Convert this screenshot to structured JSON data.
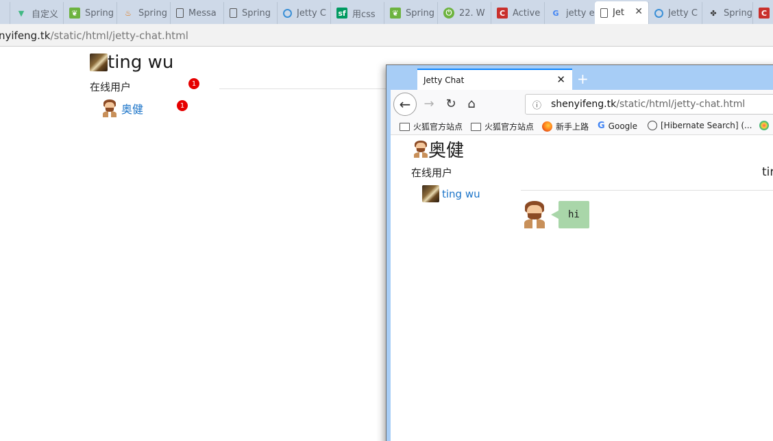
{
  "browser": {
    "tabs": [
      {
        "label": "",
        "icon": "page-icon",
        "active": false
      },
      {
        "label": "自定义",
        "icon": "vue-icon",
        "active": false
      },
      {
        "label": "Spring",
        "icon": "spring-leaf-icon",
        "active": false
      },
      {
        "label": "Spring",
        "icon": "java-icon",
        "active": false
      },
      {
        "label": "Messa",
        "icon": "document-icon",
        "active": false
      },
      {
        "label": "Spring",
        "icon": "document-icon",
        "active": false
      },
      {
        "label": "Jetty C",
        "icon": "jetty-icon",
        "active": false
      },
      {
        "label": "用css",
        "icon": "segmentfault-icon",
        "active": false
      },
      {
        "label": "Spring",
        "icon": "spring-leaf-icon",
        "active": false
      },
      {
        "label": "22. W",
        "icon": "spring-boot-icon",
        "active": false
      },
      {
        "label": "Active",
        "icon": "csdn-icon",
        "active": false
      },
      {
        "label": "jetty e",
        "icon": "google-icon",
        "active": false
      },
      {
        "label": "Jet",
        "icon": "document-icon",
        "active": true
      },
      {
        "label": "Jetty C",
        "icon": "jetty-icon",
        "active": false
      },
      {
        "label": "Spring",
        "icon": "octopus-icon",
        "active": false
      },
      {
        "label": "",
        "icon": "csdn-icon",
        "active": false
      }
    ],
    "url_host": "nyifeng.tk",
    "url_path": "/static/html/jetty-chat.html"
  },
  "page": {
    "title": "ting wu",
    "online_label": "在线用户",
    "header_badge": "1",
    "users": [
      {
        "name": "奥健",
        "badge": "1"
      }
    ]
  },
  "inner_window": {
    "tab_title": "Jetty Chat",
    "url_host": "shenyifeng.tk",
    "url_path": "/static/html/jetty-chat.html",
    "bookmarks": [
      {
        "label": "火狐官方站点",
        "icon": "folder-icon"
      },
      {
        "label": "火狐官方站点",
        "icon": "folder-icon"
      },
      {
        "label": "新手上路",
        "icon": "firefox-icon"
      },
      {
        "label": "Google",
        "icon": "google-icon"
      },
      {
        "label": "[Hibernate Search] (...",
        "icon": "globe-icon"
      },
      {
        "label": "",
        "icon": "colorful-icon"
      }
    ],
    "page": {
      "title": "奥健",
      "online_label": "在线用户",
      "chat_header": "tir",
      "users": [
        {
          "name": "ting wu"
        }
      ],
      "messages": [
        {
          "text": "hi"
        }
      ]
    }
  },
  "colors": {
    "link": "#1a73c8",
    "badge": "#e60000",
    "bubble": "#a9d6a9",
    "firefox_titlebar": "#a7cdf6"
  }
}
